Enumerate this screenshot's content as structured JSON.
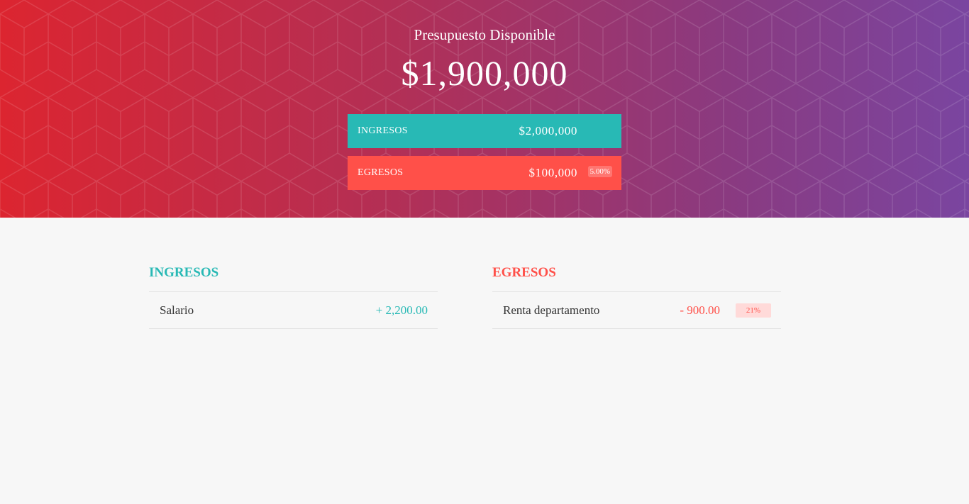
{
  "header": {
    "title": "Presupuesto Disponible",
    "value": "$1,900,000",
    "income": {
      "label": "INGRESOS",
      "value": "$2,000,000"
    },
    "expense": {
      "label": "EGRESOS",
      "value": "$100,000",
      "percentage": "5.00%"
    }
  },
  "colors": {
    "income": "#28b9b5",
    "expense": "#ff5049",
    "gradient_start": "#dc2530",
    "gradient_end": "#7a45a0"
  },
  "income_list": {
    "title": "INGRESOS",
    "items": [
      {
        "description": "Salario",
        "value": "+ 2,200.00"
      }
    ]
  },
  "expense_list": {
    "title": "EGRESOS",
    "items": [
      {
        "description": "Renta departamento",
        "value": "- 900.00",
        "percentage": "21%"
      }
    ]
  }
}
